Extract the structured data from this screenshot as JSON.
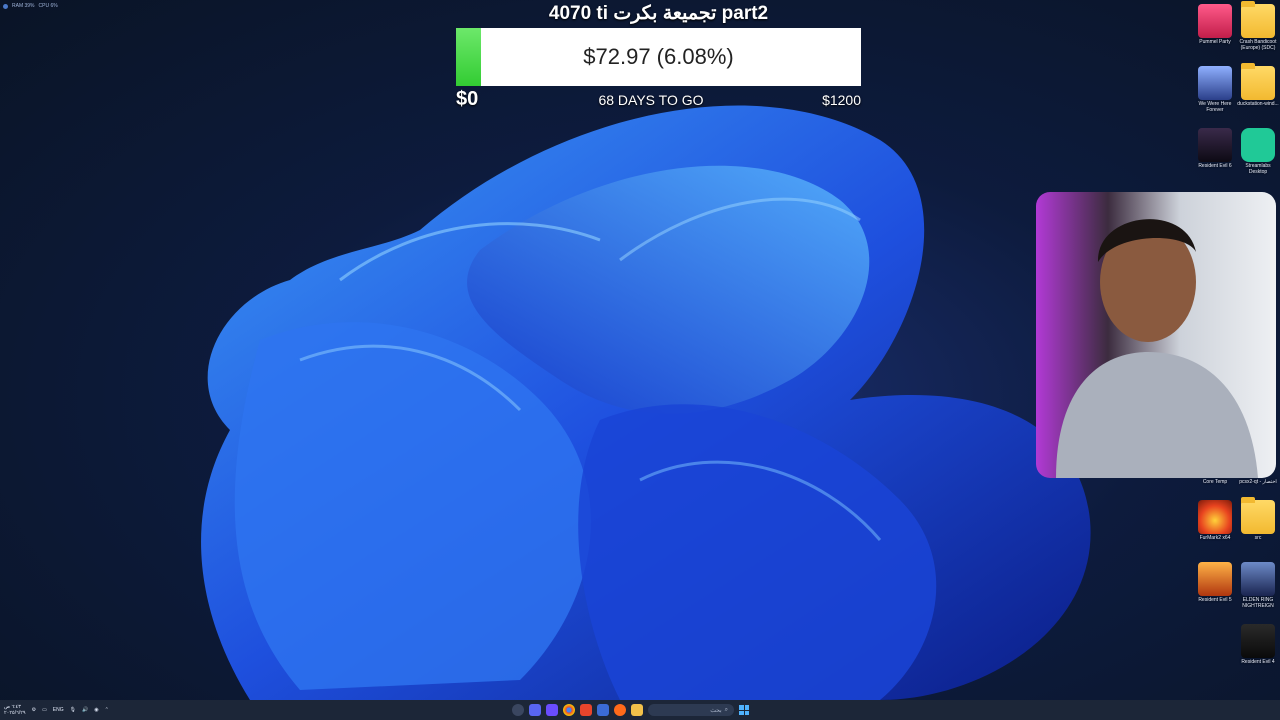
{
  "system_monitor": {
    "ram": "RAM 39%",
    "cpu": "CPU 6%"
  },
  "goal": {
    "title": "4070 ti تجميعة بكرت part2",
    "amount": "$72.97 (6.08%)",
    "min": "$0",
    "max": "$1200",
    "days_left": "68 DAYS TO GO",
    "progress_fraction": 0.0608,
    "fill_color": "#33cc33"
  },
  "desktop_icons": [
    {
      "label": "Pummel Party",
      "icon": "game-icon"
    },
    {
      "label": "Crash Bandicoot (Europe) (SDC)",
      "icon": "folder-icon"
    },
    {
      "label": "We Were Here Forever",
      "icon": "game-icon"
    },
    {
      "label": "duckstation-wind...",
      "icon": "folder-icon"
    },
    {
      "label": "Resident Evil 6",
      "icon": "game-icon"
    },
    {
      "label": "Streamlabs Desktop",
      "icon": "streamlabs-icon"
    },
    {
      "label": "Core Temp",
      "icon": "app-icon"
    },
    {
      "label": "pcsx2-qt - اختصار",
      "icon": "app-icon"
    },
    {
      "label": "FurMark2 x64",
      "icon": "furmark-icon"
    },
    {
      "label": "src",
      "icon": "folder-icon"
    },
    {
      "label": "Resident Evil 5",
      "icon": "game-icon"
    },
    {
      "label": "ELDEN RING NIGHTREIGN",
      "icon": "game-icon"
    },
    {
      "label": "Resident Evil 4",
      "icon": "game-icon"
    }
  ],
  "taskbar": {
    "lang": "ENG",
    "time": "٦:٤٣ ص",
    "date": "٢٠٢٥/٦/٢٩",
    "search_placeholder": "بحث"
  }
}
